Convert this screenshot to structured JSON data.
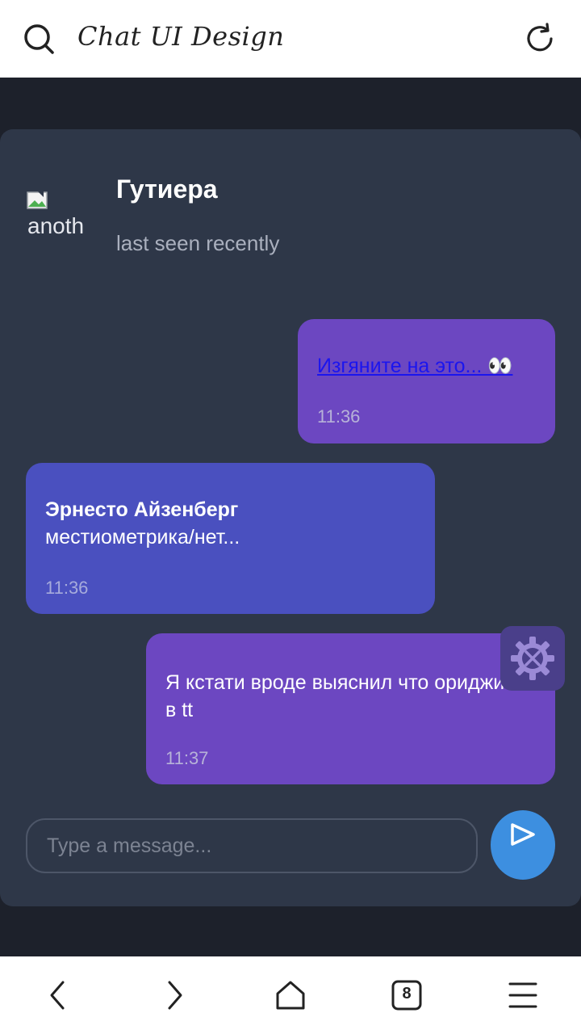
{
  "browser": {
    "title": "Chat UI Design",
    "tab_count": "8"
  },
  "chat": {
    "avatar_alt": "anoth",
    "contact_name": "Гутиера",
    "contact_status": "last seen recently",
    "messages": [
      {
        "direction": "outgoing",
        "text": "Изгяните на это... 👀",
        "is_link": true,
        "time": "11:36"
      },
      {
        "direction": "incoming",
        "sender": "Эрнесто Айзенберг",
        "text": "местиометрика/нет...",
        "time": "11:36"
      },
      {
        "direction": "outgoing",
        "text": "Я кстати вроде выяснил что ориджин в tt",
        "time": "11:37"
      }
    ],
    "input_placeholder": "Type a message..."
  },
  "colors": {
    "page_bg": "#1d212b",
    "panel_bg": "#2e3748",
    "outgoing_bubble": "#6c47c1",
    "incoming_bubble": "#4a50bf",
    "send_button": "#3d8fe0",
    "gear_button": "#4a3f8a"
  },
  "icons": {
    "search": "search-icon",
    "reload": "reload-icon",
    "broken_image": "broken-image-icon",
    "settings": "gear-wrench-icon",
    "send": "send-icon",
    "back": "chevron-left-icon",
    "forward": "chevron-right-icon",
    "home": "home-icon",
    "tabs": "tabs-icon",
    "menu": "menu-icon"
  }
}
